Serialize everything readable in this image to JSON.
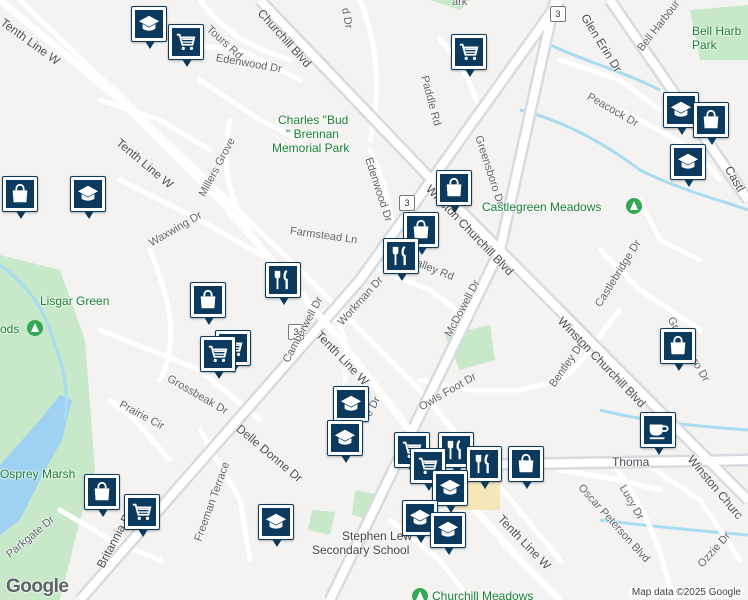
{
  "map": {
    "logo": "Google",
    "attribution": "Map data ©2025 Google",
    "colors": {
      "land": "#f4f3f1",
      "road": "#ffffff",
      "arterial": "#d7dbe0",
      "park": "#c7e8c9",
      "water": "#9fd2f2",
      "creek": "#a8dcf0",
      "pin": "#0b3a5e"
    }
  },
  "labels": {
    "tours_rd": "Tours Rd",
    "churchill_blvd_top": "Churchill Blvd",
    "ld_dr": "d Dr",
    "ark": "ark",
    "glen_erin": "Glen Erin Dr",
    "bell_harbour": "Bell Harbour Dr",
    "bell_harb_park": "Bell Harb Park",
    "tenth_line_nw": "Tenth Line W",
    "edenwood": "Edenwood Dr",
    "paddle": "Paddle Rd",
    "peacock": "Peacock Dr",
    "charles_bud_1": "Charles \"Bud",
    "charles_bud_2": "\" Brennan",
    "charles_bud_3": "Memorial Park",
    "greensboro_top": "Greensboro Dr",
    "millers": "Millers Grove",
    "edenwood_dr": "Edenwood Dr",
    "tenth_line_w2": "Tenth Line W",
    "castlegreen": "Castlegreen Meadows",
    "waxwing": "Waxwing Dr",
    "farmstead": "Farmstead Ln",
    "winston_upper": "Winston Churchill Blvd",
    "lowley": "Loyalley Rd",
    "mcdowell": "McDowell Dr",
    "castlebridge": "Castlebridge Dr",
    "greensboro_r": "Greensboro Dr",
    "lisgar": "Lisgar Green",
    "ods": "ods",
    "workman": "Workman Dr",
    "tenth_line_mid": "Tenth Line W",
    "winston_lower": "Winston Churchill Blvd",
    "camberwell": "Camberwell Dr",
    "grossbeak": "Grossbeak Dr",
    "prairie": "Prairie Cir",
    "bentley": "Bentley Dr",
    "owls": "Owls Foot Dr",
    "edr": "e Dr",
    "delle": "Delle Donne Dr",
    "thoma": "Thoma",
    "lucy": "Lucy Dr",
    "winston_churc": "Winston Churc",
    "oscar": "Oscar Peterson Blvd",
    "britannia": "Britannia Rd W",
    "osprey": "Osprey Marsh",
    "freeman": "Freeman Terrace",
    "parkgate": "Parkgate Dr",
    "tenth_line_bottom": "Tenth Line W",
    "ozzie": "Ozzie Dr",
    "stephen_1": "Stephen Lew",
    "stephen_2": "Secondary School",
    "churchill_meadows": "Churchill Meadows",
    "castle_r": "Castl",
    "route_3a": "3",
    "route_3b": "3",
    "route_3c": "3"
  },
  "markers": [
    {
      "name": "school-marker-1",
      "icon": "school"
    },
    {
      "name": "shopping-cart-marker-1",
      "icon": "cart"
    },
    {
      "name": "shopping-cart-marker-2",
      "icon": "cart"
    },
    {
      "name": "school-marker-2",
      "icon": "school"
    },
    {
      "name": "shopping-bag-marker-1",
      "icon": "bag"
    },
    {
      "name": "school-marker-3",
      "icon": "school"
    },
    {
      "name": "shopping-bag-marker-2",
      "icon": "bag"
    },
    {
      "name": "school-marker-4",
      "icon": "school"
    },
    {
      "name": "shopping-bag-marker-3",
      "icon": "bag"
    },
    {
      "name": "shopping-bag-marker-4",
      "icon": "bag"
    },
    {
      "name": "restaurant-marker-1",
      "icon": "food"
    },
    {
      "name": "restaurant-marker-2",
      "icon": "food"
    },
    {
      "name": "shopping-bag-marker-5",
      "icon": "bag"
    },
    {
      "name": "shopping-cart-marker-3",
      "icon": "cart"
    },
    {
      "name": "shopping-cart-marker-4",
      "icon": "cart"
    },
    {
      "name": "shopping-bag-marker-6",
      "icon": "bag"
    },
    {
      "name": "school-marker-5",
      "icon": "school"
    },
    {
      "name": "school-marker-6",
      "icon": "school"
    },
    {
      "name": "cafe-marker-1",
      "icon": "cafe"
    },
    {
      "name": "shopping-cart-marker-5",
      "icon": "cart"
    },
    {
      "name": "restaurant-marker-3",
      "icon": "food"
    },
    {
      "name": "shopping-cart-marker-6",
      "icon": "cart"
    },
    {
      "name": "restaurant-marker-4",
      "icon": "food"
    },
    {
      "name": "shopping-bag-marker-7",
      "icon": "bag"
    },
    {
      "name": "school-marker-7",
      "icon": "school"
    },
    {
      "name": "shopping-bag-marker-8",
      "icon": "bag"
    },
    {
      "name": "shopping-cart-marker-7",
      "icon": "cart"
    },
    {
      "name": "school-marker-8",
      "icon": "school"
    },
    {
      "name": "school-marker-9",
      "icon": "school"
    },
    {
      "name": "school-marker-10",
      "icon": "school"
    }
  ]
}
